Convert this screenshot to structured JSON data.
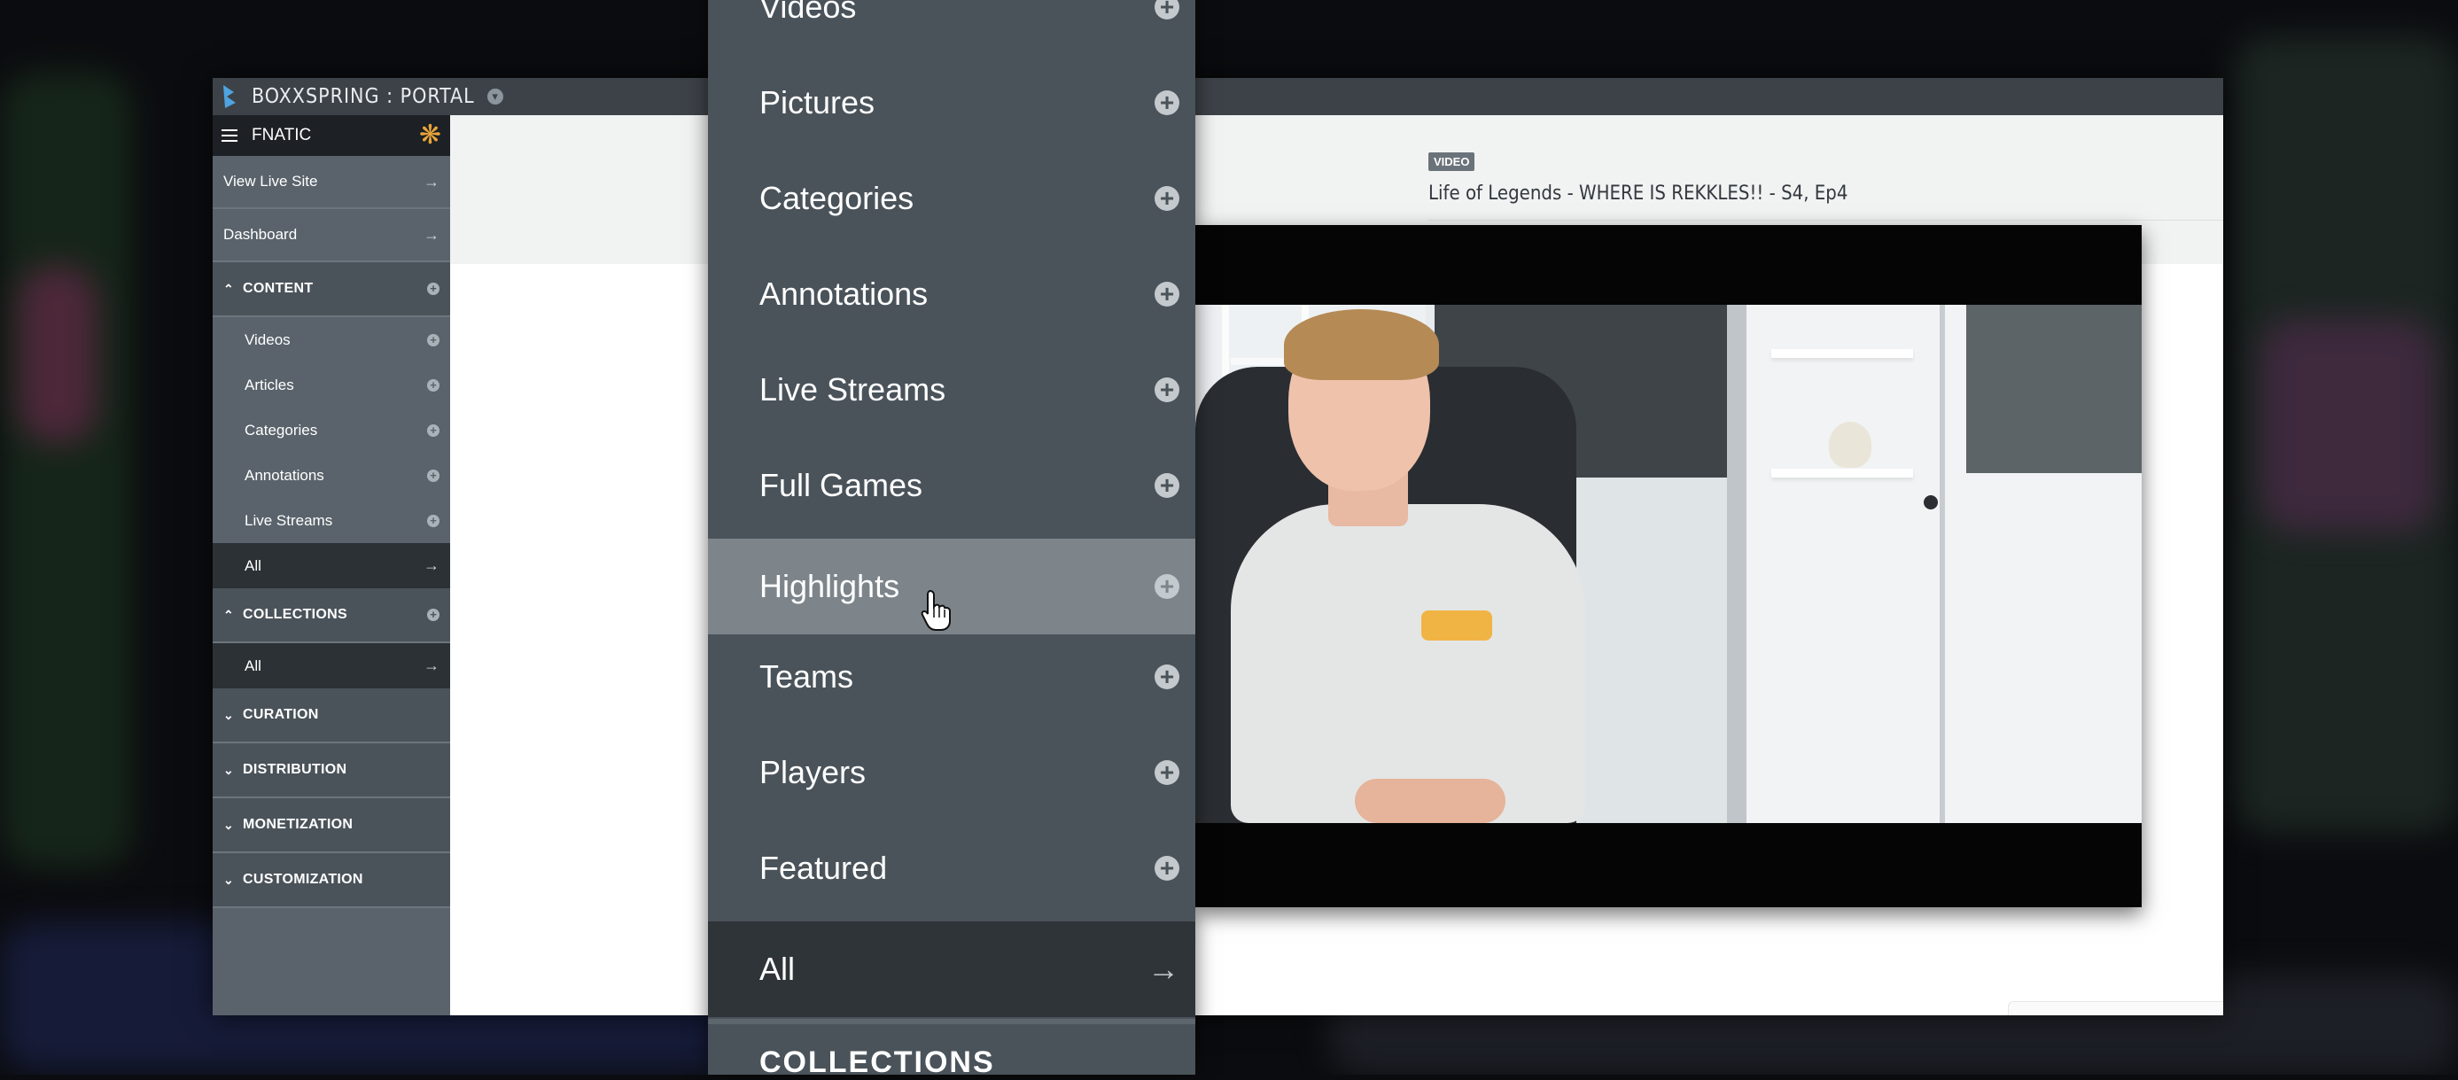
{
  "app": {
    "brand_name": "BOXXSPRING : PORTAL",
    "org_name": "FNATIC",
    "accent_color": "#e8a53a",
    "brand_color": "#4fa3e0"
  },
  "sidebar": {
    "links": [
      {
        "label": "View Live Site"
      },
      {
        "label": "Dashboard"
      }
    ],
    "content_section": {
      "title": "CONTENT",
      "items": [
        {
          "label": "Videos"
        },
        {
          "label": "Articles"
        },
        {
          "label": "Categories"
        },
        {
          "label": "Annotations"
        },
        {
          "label": "Live Streams"
        }
      ],
      "all_label": "All"
    },
    "collections_section": {
      "title": "COLLECTIONS",
      "all_label": "All"
    },
    "collapsed_sections": [
      {
        "title": "CURATION"
      },
      {
        "title": "DISTRIBUTION"
      },
      {
        "title": "MONETIZATION"
      },
      {
        "title": "CUSTOMIZATION"
      }
    ]
  },
  "main": {
    "tag": "VIDEO",
    "title": "Life of Legends - WHERE IS REKKLES!! - S4, Ep4"
  },
  "menu": {
    "items": [
      {
        "label": "Videos"
      },
      {
        "label": "Pictures"
      },
      {
        "label": "Categories"
      },
      {
        "label": "Annotations"
      },
      {
        "label": "Live Streams"
      },
      {
        "label": "Full Games"
      },
      {
        "label": "Highlights",
        "active": true
      },
      {
        "label": "Teams"
      },
      {
        "label": "Players"
      },
      {
        "label": "Featured"
      }
    ],
    "all_label": "All",
    "next_section_cut": "COLLECTIONS"
  },
  "icons": {
    "plus": "plus-circle-icon",
    "arrow": "arrow-right-icon",
    "caret_up": "chevron-up-icon",
    "caret_down": "chevron-down-icon",
    "cursor": "hand-pointer-icon"
  }
}
